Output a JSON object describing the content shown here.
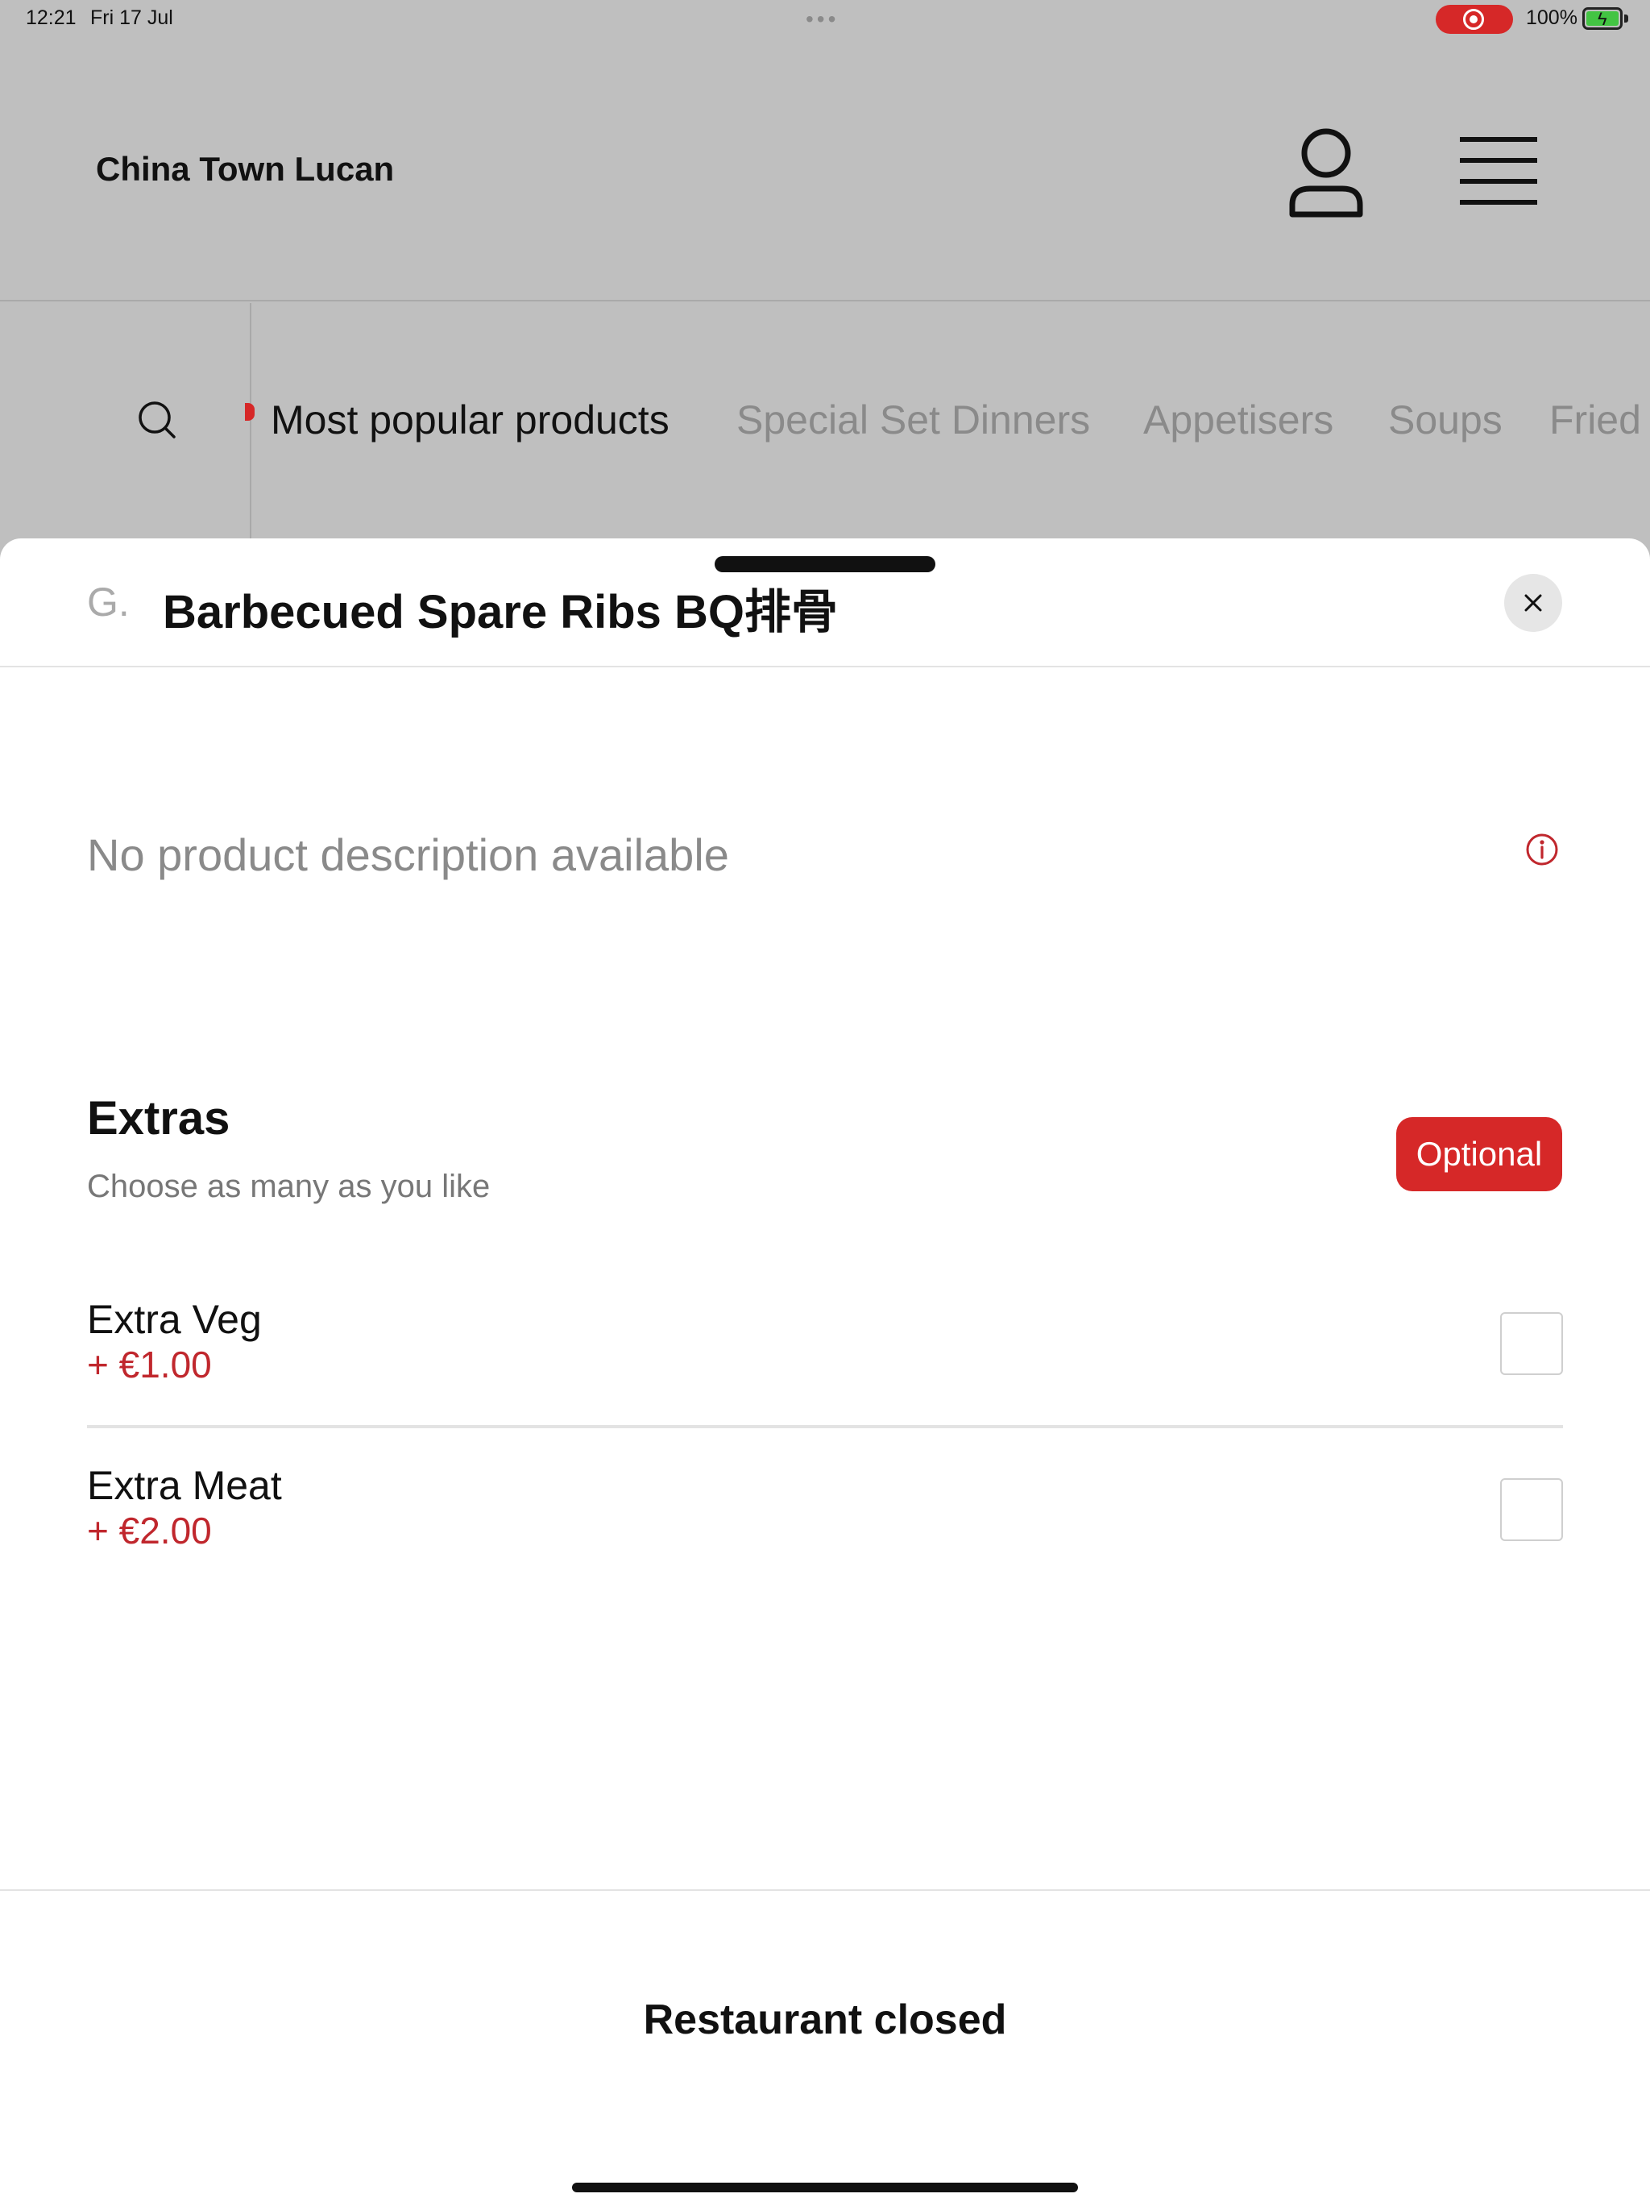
{
  "status_bar": {
    "time": "12:21",
    "date": "Fri 17 Jul",
    "dots": "•••",
    "battery_percent": "100%"
  },
  "header": {
    "restaurant_name": "China Town Lucan",
    "icons": [
      "person-icon",
      "hamburger-menu-icon"
    ]
  },
  "categories": {
    "tabs": [
      {
        "label": "Most popular products",
        "active": true
      },
      {
        "label": "Special Set Dinners",
        "active": false
      },
      {
        "label": "Appetisers",
        "active": false
      },
      {
        "label": "Soups",
        "active": false
      },
      {
        "label": "Fried",
        "active": false
      }
    ]
  },
  "product": {
    "code": "G.",
    "title": "Barbecued  Spare Ribs BQ排骨",
    "description": "No product description available"
  },
  "extras": {
    "title": "Extras",
    "subtitle": "Choose as many as you like",
    "badge": "Optional",
    "options": [
      {
        "name": "Extra Veg",
        "price": "+ €1.00",
        "checked": false
      },
      {
        "name": "Extra Meat",
        "price": "+ €2.00",
        "checked": false
      }
    ]
  },
  "footer": {
    "status_label": "Restaurant closed"
  },
  "colors": {
    "accent": "#d62828",
    "price": "#c0272d",
    "overlay_gray": "#bfbfbf"
  }
}
